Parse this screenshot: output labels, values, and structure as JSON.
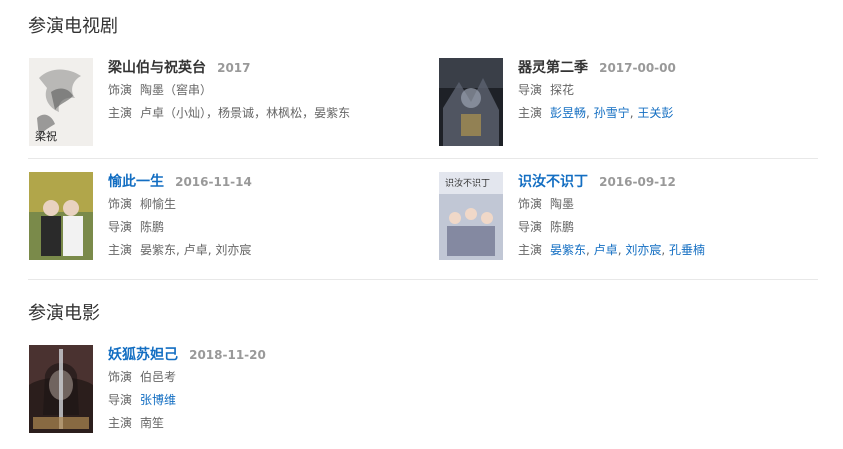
{
  "tv": {
    "heading": "参演电视剧",
    "items": [
      {
        "title": "梁山伯与祝英台",
        "date": "2017",
        "role_label": "饰演",
        "role": "陶墨（窖串）",
        "people_label": "主演",
        "people": [
          "卢卓（小灿）",
          "杨景诚",
          "林枫松",
          "晏紫东"
        ],
        "poster_text": "梁祝"
      },
      {
        "title": "器灵第二季",
        "date": "2017-00-00",
        "role_label": "导演",
        "role": "探花",
        "people_label": "主演",
        "people": [
          "彭昱畅",
          "孙雪宁",
          "王关彭"
        ]
      },
      {
        "title": "愉此一生",
        "date": "2016-11-14",
        "role_label": "饰演",
        "role": "柳愉生",
        "director_label": "导演",
        "director": "陈鹏",
        "people_label": "主演",
        "people": [
          "晏紫东",
          "卢卓",
          "刘亦宸"
        ]
      },
      {
        "title": "识汝不识丁",
        "date": "2016-09-12",
        "role_label": "饰演",
        "role": "陶墨",
        "director_label": "导演",
        "director": "陈鹏",
        "people_label": "主演",
        "people": [
          "晏紫东",
          "卢卓",
          "刘亦宸",
          "孔垂楠"
        ],
        "poster_text": "识汝不识丁"
      }
    ]
  },
  "movie": {
    "heading": "参演电影",
    "items": [
      {
        "title": "妖狐苏妲己",
        "date": "2018-11-20",
        "role_label": "饰演",
        "role": "伯邑考",
        "director_label": "导演",
        "director": "张博维",
        "people_label": "主演",
        "people": [
          "南笙"
        ]
      }
    ]
  }
}
